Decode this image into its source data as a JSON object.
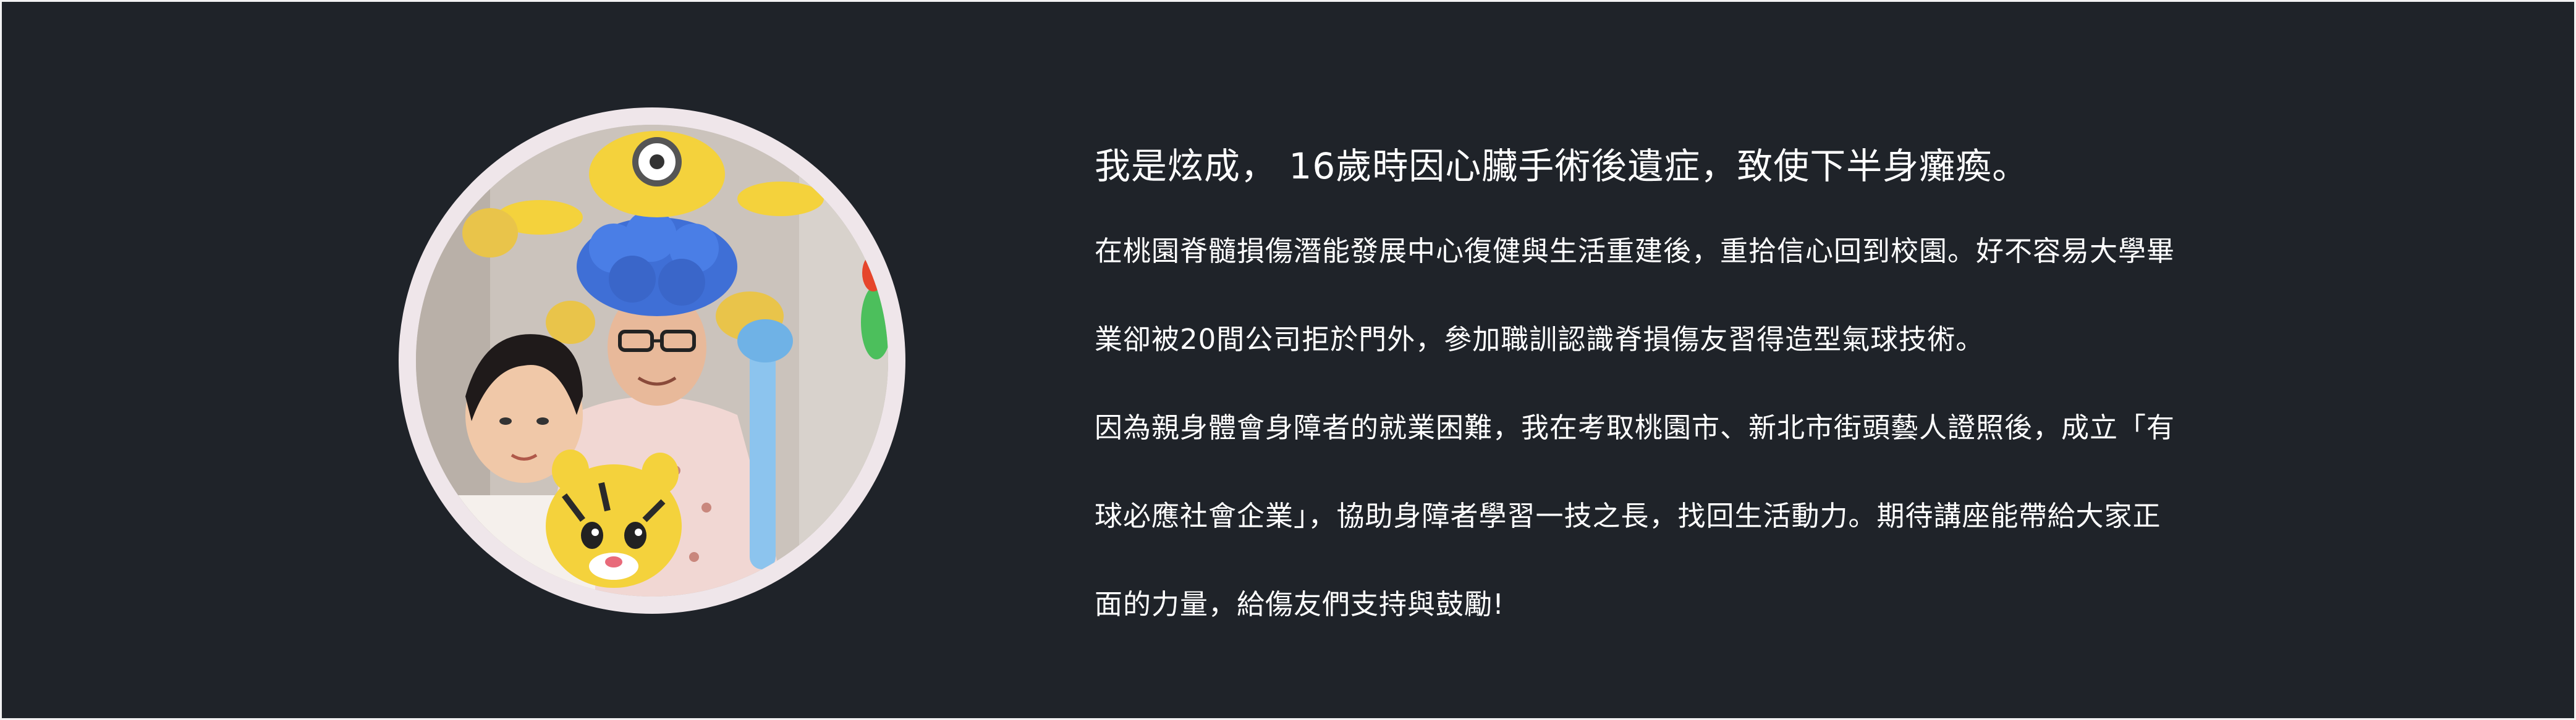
{
  "profile": {
    "photo_subject": "portrait-photo-balloon-artist-with-child",
    "ring_color": "#efe6ea",
    "background_color": "#1f2329"
  },
  "bio": {
    "headline": "我是炫成， 16歲時因心臟手術後遺症，致使下半身癱瘓。",
    "lines": [
      "在桃園脊髓損傷潛能發展中心復健與生活重建後，重拾信心回到校園。好不容易大學畢",
      "業卻被20間公司拒於門外，參加職訓認識脊損傷友習得造型氣球技術。",
      "因為親身體會身障者的就業困難，我在考取桃園市、新北市街頭藝人證照後，成立「有",
      "球必應社會企業」，協助身障者學習一技之長，找回生活動力。期待講座能帶給大家正",
      "面的力量，給傷友們支持與鼓勵!"
    ]
  }
}
